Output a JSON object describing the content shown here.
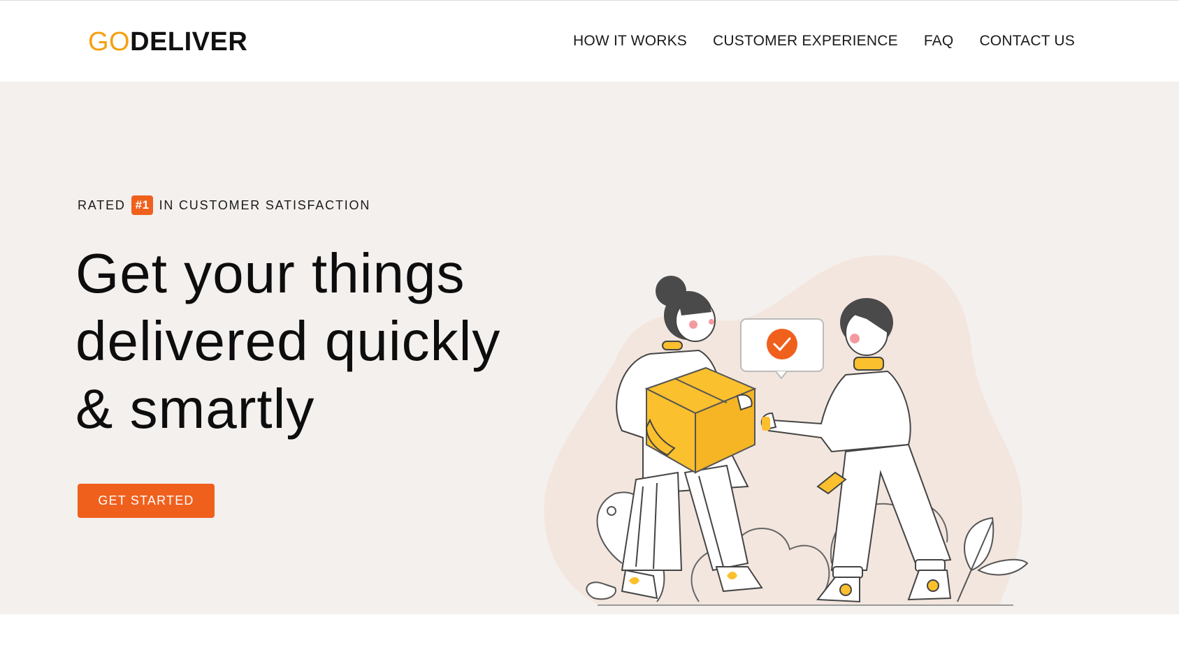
{
  "header": {
    "logo": {
      "part1": "GO",
      "part2": "DELIVER"
    },
    "nav": [
      {
        "label": "HOW IT WORKS"
      },
      {
        "label": "CUSTOMER EXPERIENCE"
      },
      {
        "label": "FAQ"
      },
      {
        "label": "CONTACT US"
      }
    ]
  },
  "hero": {
    "tagline_prefix": "RATED",
    "tagline_badge": "#1",
    "tagline_suffix": "IN CUSTOMER SATISFACTION",
    "headline_lines": [
      "Get your things",
      "delivered quickly",
      "& smartly"
    ],
    "cta_label": "GET STARTED"
  },
  "colors": {
    "accent_orange": "#f0601d",
    "logo_yellow": "#f5a00f",
    "hero_bg": "#f4f0ee",
    "box_yellow": "#fbc02d"
  },
  "icons": {
    "check": "check-circle-icon"
  }
}
